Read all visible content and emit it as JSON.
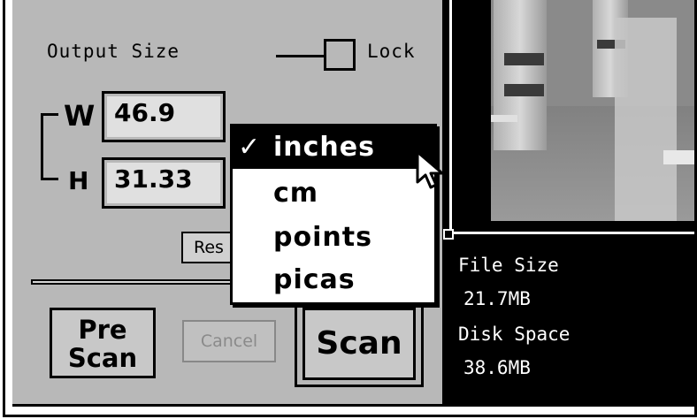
{
  "output_size": {
    "title": "Output Size",
    "lock_label": "Lock",
    "width_label": "W",
    "height_label": "H",
    "width_value": "46.9",
    "height_value": "31.33",
    "reset_label_partial": "Res"
  },
  "unit_menu": {
    "items": [
      "inches",
      "cm",
      "points",
      "picas"
    ],
    "selected_index": 0,
    "check_mark": "✓"
  },
  "buttons": {
    "prescan_line1": "Pre",
    "prescan_line2": "Scan",
    "cancel": "Cancel",
    "scan": "Scan"
  },
  "info": {
    "file_size_label": "File Size",
    "file_size_value": "21.7MB",
    "disk_space_label": "Disk Space",
    "disk_space_value": "38.6MB"
  },
  "colors": {
    "panel_bg": "#b8b8b8",
    "preview_bg": "#000000",
    "field_bg": "#e0e0e0"
  }
}
